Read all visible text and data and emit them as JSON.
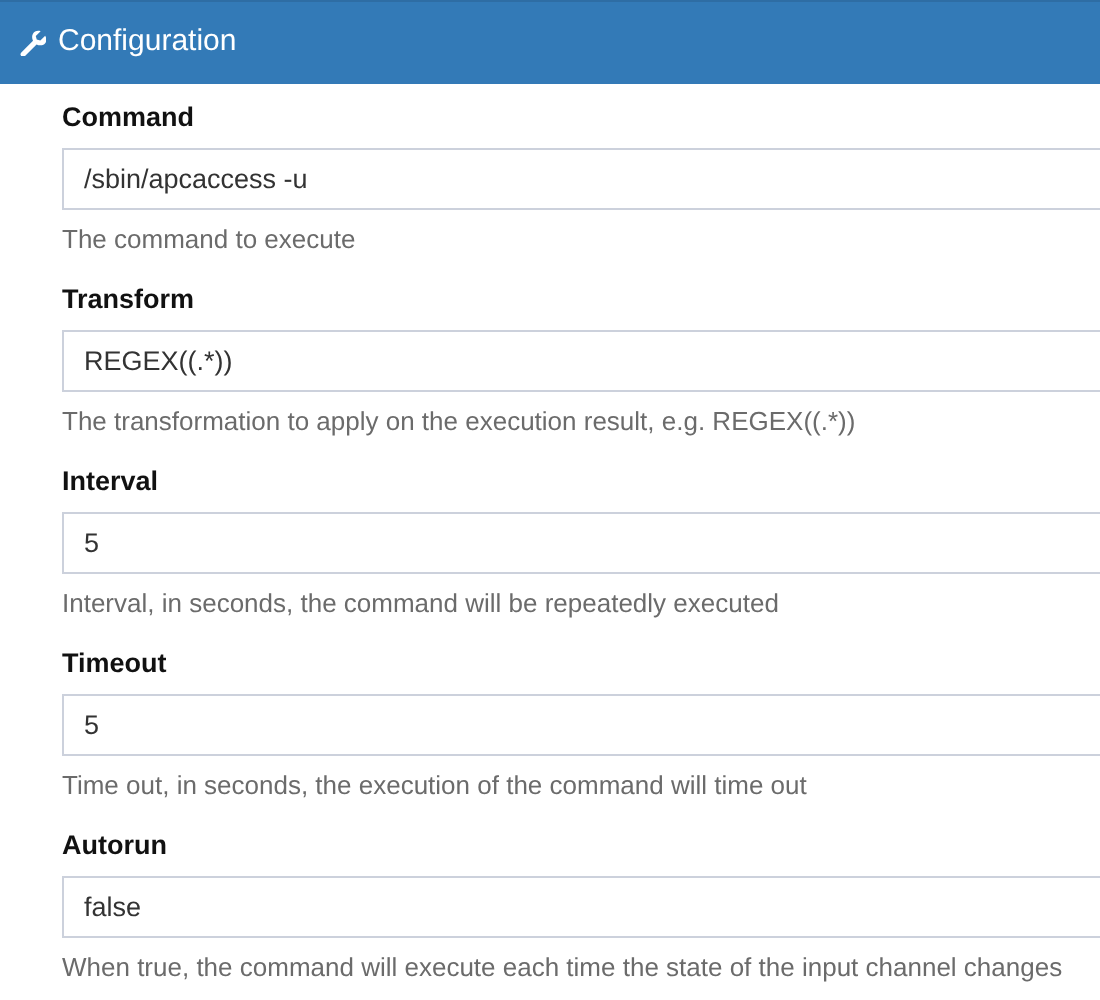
{
  "panel": {
    "title": "Configuration"
  },
  "fields": [
    {
      "label": "Command",
      "value": "/sbin/apcaccess -u",
      "help": "The command to execute"
    },
    {
      "label": "Transform",
      "value": "REGEX((.*))",
      "help": "The transformation to apply on the execution result, e.g. REGEX((.*))"
    },
    {
      "label": "Interval",
      "value": "5",
      "help": "Interval, in seconds, the command will be repeatedly executed"
    },
    {
      "label": "Timeout",
      "value": "5",
      "help": "Time out, in seconds, the execution of the command will time out"
    },
    {
      "label": "Autorun",
      "value": "false",
      "help": "When true, the command will execute each time the state of the input channel changes"
    }
  ]
}
